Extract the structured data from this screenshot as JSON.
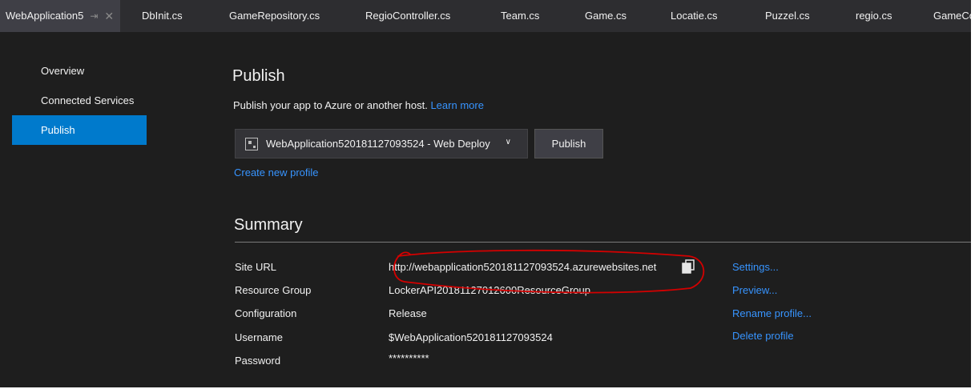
{
  "tabs": [
    {
      "label": "WebApplication5",
      "active": true
    },
    {
      "label": "DbInit.cs"
    },
    {
      "label": "GameRepository.cs"
    },
    {
      "label": "RegioController.cs"
    },
    {
      "label": "Team.cs"
    },
    {
      "label": "Game.cs"
    },
    {
      "label": "Locatie.cs"
    },
    {
      "label": "Puzzel.cs"
    },
    {
      "label": "regio.cs"
    },
    {
      "label": "GameCo"
    }
  ],
  "nav": {
    "items": [
      {
        "label": "Overview"
      },
      {
        "label": "Connected Services"
      },
      {
        "label": "Publish",
        "selected": true
      }
    ]
  },
  "publish": {
    "title": "Publish",
    "subtitle": "Publish your app to Azure or another host.",
    "learn_more": "Learn more",
    "profile_selected": "WebApplication520181127093524 - Web Deploy",
    "publish_button": "Publish",
    "create_profile": "Create new profile"
  },
  "summary": {
    "title": "Summary",
    "rows": [
      {
        "label": "Site URL",
        "value": "http://webapplication520181127093524.azurewebsites.net"
      },
      {
        "label": "Resource Group",
        "value": "LockerAPI20181127012600ResourceGroup"
      },
      {
        "label": "Configuration",
        "value": "Release"
      },
      {
        "label": "Username",
        "value": "$WebApplication520181127093524"
      },
      {
        "label": "Password",
        "value": "**********"
      }
    ],
    "actions": [
      {
        "label": "Settings..."
      },
      {
        "label": "Preview..."
      },
      {
        "label": "Rename profile..."
      },
      {
        "label": "Delete profile"
      }
    ]
  },
  "colors": {
    "accent": "#007acc",
    "link": "#3794ff",
    "background": "#1e1e1e",
    "annotation": "#d40000"
  },
  "icons": [
    "pin-icon",
    "close-icon",
    "profile-icon",
    "chevron-down-icon",
    "copy-icon"
  ]
}
